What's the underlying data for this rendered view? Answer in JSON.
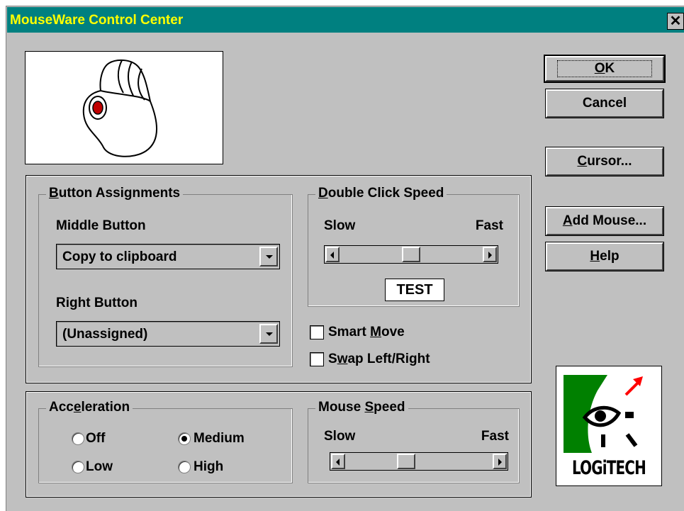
{
  "window": {
    "title": "MouseWare Control Center",
    "close_glyph": "✕"
  },
  "buttons": {
    "ok": {
      "pre": "",
      "mn": "O",
      "post": "K"
    },
    "cancel": {
      "label": "Cancel"
    },
    "cursor": {
      "pre": "",
      "mn": "C",
      "post": "ursor..."
    },
    "add_mouse": {
      "pre": "",
      "mn": "A",
      "post": "dd Mouse..."
    },
    "help": {
      "pre": "",
      "mn": "H",
      "post": "elp"
    }
  },
  "button_assignments": {
    "legend_mn": "B",
    "legend_rest": "utton Assignments",
    "middle_label": "Middle Button",
    "middle_value": "Copy to clipboard",
    "right_label": "Right Button",
    "right_value": "(Unassigned)"
  },
  "double_click": {
    "legend_mn": "D",
    "legend_rest": "ouble Click Speed",
    "slow": "Slow",
    "fast": "Fast",
    "test": "TEST",
    "position": 0.5
  },
  "options": {
    "smart_move": {
      "pre": "Smart ",
      "mn": "M",
      "post": "ove",
      "checked": false
    },
    "swap": {
      "pre": "S",
      "mn": "w",
      "post": "ap Left/Right",
      "checked": false
    }
  },
  "acceleration": {
    "legend_pre": "Acc",
    "legend_mn": "e",
    "legend_post": "leration",
    "options": [
      {
        "label": "Off",
        "selected": false
      },
      {
        "label": "Low",
        "selected": false
      },
      {
        "label": "Medium",
        "selected": true
      },
      {
        "label": "High",
        "selected": false
      }
    ]
  },
  "mouse_speed": {
    "legend_pre": "Mouse ",
    "legend_mn": "S",
    "legend_post": "peed",
    "slow": "Slow",
    "fast": "Fast",
    "position": 0.4
  },
  "logo": {
    "text": "LOGiTECH"
  },
  "colors": {
    "title_bar": "#008080",
    "title_text": "#ffff00",
    "face": "#c0c0c0",
    "mouse_button": "#c00000",
    "logo_green": "#008000",
    "logo_arrow": "#ff0000"
  }
}
